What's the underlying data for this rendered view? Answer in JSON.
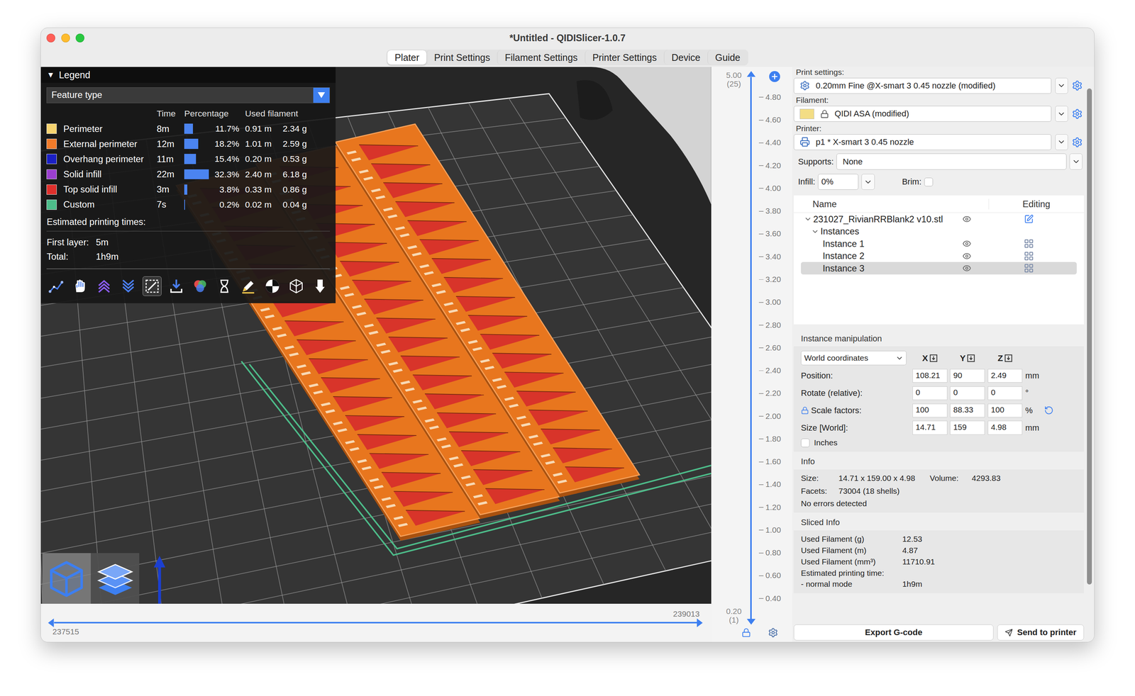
{
  "window": {
    "title": "*Untitled - QIDISlicer-1.0.7"
  },
  "tabs": [
    {
      "label": "Plater",
      "selected": true
    },
    {
      "label": "Print Settings",
      "selected": false
    },
    {
      "label": "Filament Settings",
      "selected": false
    },
    {
      "label": "Printer Settings",
      "selected": false
    },
    {
      "label": "Device",
      "selected": false
    },
    {
      "label": "Guide",
      "selected": false
    }
  ],
  "legend": {
    "toggle": "▼",
    "title": "Legend",
    "expanded": true,
    "view_type": "Feature type",
    "columns": [
      "Time",
      "Percentage",
      "Used filament"
    ],
    "rows": [
      {
        "name": "Perimeter",
        "time": "8m",
        "percentage": "11.7%",
        "level": 0.117,
        "length": "0.91 m",
        "weight": "2.34 g",
        "color": "#f5d36f"
      },
      {
        "name": "External perimeter",
        "time": "12m",
        "percentage": "18.2%",
        "level": 0.182,
        "length": "1.01 m",
        "weight": "2.59 g",
        "color": "#f07b2a"
      },
      {
        "name": "Overhang perimeter",
        "time": "11m",
        "percentage": "15.4%",
        "level": 0.154,
        "length": "0.20 m",
        "weight": "0.53 g",
        "color": "#1a1fc4"
      },
      {
        "name": "Solid infill",
        "time": "22m",
        "percentage": "32.3%",
        "level": 0.323,
        "length": "2.40 m",
        "weight": "6.18 g",
        "color": "#9b3fcf"
      },
      {
        "name": "Top solid infill",
        "time": "3m",
        "percentage": "3.8%",
        "level": 0.038,
        "length": "0.33 m",
        "weight": "0.86 g",
        "color": "#e0302c"
      },
      {
        "name": "Custom",
        "time": "7s",
        "percentage": "0.2%",
        "level": 0.002,
        "length": "0.02 m",
        "weight": "0.04 g",
        "color": "#4dbd8a"
      }
    ],
    "estimated_title": "Estimated printing times:",
    "times": [
      {
        "label": "First layer:",
        "value": "5m"
      },
      {
        "label": "Total:",
        "value": "1h9m"
      }
    ],
    "tools": [
      {
        "kind": "travel",
        "selected": false
      },
      {
        "kind": "wipe",
        "selected": false
      },
      {
        "kind": "retractions",
        "selected": false
      },
      {
        "kind": "deretractions",
        "selected": false
      },
      {
        "kind": "seams",
        "selected": true
      },
      {
        "kind": "tool-changes",
        "selected": false
      },
      {
        "kind": "color-changes",
        "selected": false
      },
      {
        "kind": "pause",
        "selected": false
      },
      {
        "kind": "custom-gcode",
        "selected": false
      },
      {
        "kind": "center-of-gravity",
        "selected": false
      },
      {
        "kind": "shells",
        "selected": false
      },
      {
        "kind": "tool-marker",
        "selected": false
      }
    ]
  },
  "view_modes": [
    {
      "kind": "3d",
      "selected": false
    },
    {
      "kind": "preview",
      "selected": true
    }
  ],
  "layer_slider": {
    "top": "5.00",
    "top_layer": "(25)",
    "bottom": "0.20",
    "bottom_layer": "(1)",
    "ticks": [
      "4.80",
      "4.60",
      "4.40",
      "4.20",
      "4.00",
      "3.80",
      "3.60",
      "3.40",
      "3.20",
      "3.00",
      "2.80",
      "2.60",
      "2.40",
      "2.20",
      "2.00",
      "1.80",
      "1.60",
      "1.40",
      "1.20",
      "1.00",
      "0.80",
      "0.60",
      "0.40"
    ],
    "level": 1,
    "locked": true
  },
  "move_slider": {
    "start": "237515",
    "end": "239013",
    "level": 1
  },
  "sidebar": {
    "presets": [
      {
        "kind": "print",
        "label": "Print settings:",
        "value": "0.20mm Fine @X-smart 3 0.45 nozzle (modified)"
      },
      {
        "kind": "filament",
        "label": "Filament:",
        "value": "QIDI ASA (modified)",
        "color": "#f3dd85"
      },
      {
        "kind": "printer",
        "label": "Printer:",
        "value": "p1 * X-smart 3 0.45 nozzle"
      }
    ],
    "supports": {
      "label": "Supports:",
      "value": "None"
    },
    "infill": {
      "label": "Infill:",
      "value": "0%"
    },
    "brim": {
      "label": "Brim:",
      "checked": false
    },
    "object_list": {
      "columns": [
        "Name",
        "Editing"
      ],
      "object": {
        "name": "231027_RivianRRBlank2 v10.stl",
        "expanded": true,
        "visible": true
      },
      "group": {
        "name": "Instances",
        "expanded": true
      },
      "instances": [
        {
          "name": "Instance 1",
          "visible": true,
          "selected": false
        },
        {
          "name": "Instance 2",
          "visible": true,
          "selected": false
        },
        {
          "name": "Instance 3",
          "visible": true,
          "selected": true
        }
      ]
    },
    "manipulation": {
      "title": "Instance manipulation",
      "coordinates": "World coordinates",
      "axes": [
        "X",
        "Y",
        "Z"
      ],
      "rows": [
        {
          "label": "Position:",
          "values": [
            "108.21",
            "90",
            "2.49"
          ],
          "unit": "mm",
          "locked": false,
          "reset": false
        },
        {
          "label": "Rotate (relative):",
          "values": [
            "0",
            "0",
            "0"
          ],
          "unit": "°",
          "locked": false,
          "reset": false
        },
        {
          "label": "Scale factors:",
          "values": [
            "100",
            "88.33",
            "100"
          ],
          "unit": "%",
          "locked": true,
          "reset": true
        },
        {
          "label": "Size [World]:",
          "values": [
            "14.71",
            "159",
            "4.98"
          ],
          "unit": "mm",
          "locked": false,
          "reset": false
        }
      ],
      "inches": {
        "label": "Inches",
        "checked": false
      }
    },
    "info": {
      "title": "Info",
      "size_label": "Size:",
      "size": "14.71 x 159.00 x 4.98",
      "volume_label": "Volume:",
      "volume": "4293.83",
      "facets_label": "Facets:",
      "facets": "73004 (18 shells)",
      "status": "No errors detected"
    },
    "sliced_info": {
      "title": "Sliced Info",
      "rows": [
        {
          "label": "Used Filament (g)",
          "value": "12.53"
        },
        {
          "label": "Used Filament (m)",
          "value": "4.87"
        },
        {
          "label": "Used Filament (mm³)",
          "value": "11710.91"
        },
        {
          "label": "Estimated printing time:",
          "value": ""
        },
        {
          "label": "- normal mode",
          "value": "1h9m"
        }
      ]
    },
    "buttons": [
      {
        "label": "Export G-code",
        "kind": "export"
      },
      {
        "label": "Send to printer",
        "kind": "send"
      }
    ],
    "scrollbar": {
      "level": 0.93
    }
  }
}
